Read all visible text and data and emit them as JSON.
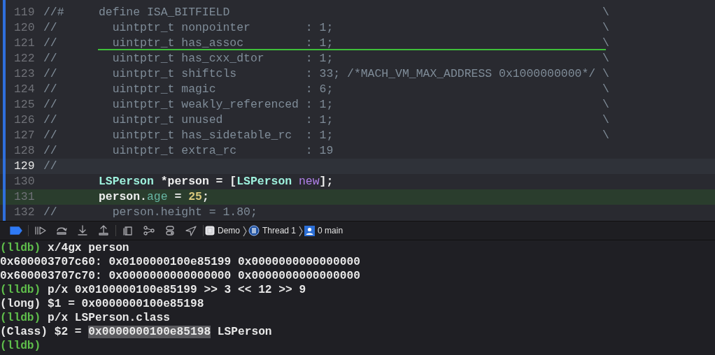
{
  "editor": {
    "lines": [
      {
        "number": "119",
        "cursor": false,
        "executing": false,
        "rule_below": false,
        "tokens": [
          {
            "text": "//#     define ISA_BITFIELD                                                      \\",
            "kind": "comment"
          }
        ]
      },
      {
        "number": "120",
        "cursor": false,
        "executing": false,
        "rule_below": false,
        "tokens": [
          {
            "text": "//        uintptr_t nonpointer        : 1;                                       \\",
            "kind": "comment"
          }
        ]
      },
      {
        "number": "121",
        "cursor": false,
        "executing": false,
        "rule_below": true,
        "tokens": [
          {
            "text": "//        uintptr_t has_assoc         : 1;                                       \\",
            "kind": "comment"
          }
        ]
      },
      {
        "number": "122",
        "cursor": false,
        "executing": false,
        "rule_below": false,
        "tokens": [
          {
            "text": "//        uintptr_t has_cxx_dtor      : 1;                                       \\",
            "kind": "comment"
          }
        ]
      },
      {
        "number": "123",
        "cursor": false,
        "executing": false,
        "rule_below": false,
        "tokens": [
          {
            "text": "//        uintptr_t shiftcls          : 33; /*MACH_VM_MAX_ADDRESS 0x1000000000*/ \\",
            "kind": "comment"
          }
        ]
      },
      {
        "number": "124",
        "cursor": false,
        "executing": false,
        "rule_below": false,
        "tokens": [
          {
            "text": "//        uintptr_t magic             : 6;                                       \\",
            "kind": "comment"
          }
        ]
      },
      {
        "number": "125",
        "cursor": false,
        "executing": false,
        "rule_below": false,
        "tokens": [
          {
            "text": "//        uintptr_t weakly_referenced : 1;                                       \\",
            "kind": "comment"
          }
        ]
      },
      {
        "number": "126",
        "cursor": false,
        "executing": false,
        "rule_below": false,
        "tokens": [
          {
            "text": "//        uintptr_t unused            : 1;                                       \\",
            "kind": "comment"
          }
        ]
      },
      {
        "number": "127",
        "cursor": false,
        "executing": false,
        "rule_below": false,
        "tokens": [
          {
            "text": "//        uintptr_t has_sidetable_rc  : 1;                                       \\",
            "kind": "comment"
          }
        ]
      },
      {
        "number": "128",
        "cursor": false,
        "executing": false,
        "rule_below": false,
        "tokens": [
          {
            "text": "//        uintptr_t extra_rc          : 19",
            "kind": "comment"
          }
        ]
      },
      {
        "number": "129",
        "cursor": true,
        "executing": false,
        "rule_below": false,
        "tokens": [
          {
            "text": "//",
            "kind": "comment"
          }
        ]
      },
      {
        "number": "130",
        "cursor": false,
        "executing": false,
        "rule_below": false,
        "tokens": [
          {
            "text": "        LSPerson",
            "kind": "class"
          },
          {
            "text": " *person = [",
            "kind": "plain"
          },
          {
            "text": "LSPerson",
            "kind": "class"
          },
          {
            "text": " new",
            "kind": "method"
          },
          {
            "text": "];",
            "kind": "plain"
          }
        ]
      },
      {
        "number": "131",
        "cursor": false,
        "executing": true,
        "rule_below": false,
        "tokens": [
          {
            "text": "        person.",
            "kind": "plain"
          },
          {
            "text": "age",
            "kind": "property"
          },
          {
            "text": " = ",
            "kind": "plain"
          },
          {
            "text": "25",
            "kind": "number"
          },
          {
            "text": ";",
            "kind": "plain"
          }
        ]
      },
      {
        "number": "132",
        "cursor": false,
        "executing": false,
        "rule_below": false,
        "tokens": [
          {
            "text": "//        person.height = 1.80;",
            "kind": "comment"
          }
        ]
      }
    ]
  },
  "debug_bar": {
    "breakpoints_active": true,
    "breadcrumbs": [
      {
        "label": "Demo",
        "kind": "app"
      },
      {
        "label": "Thread 1",
        "kind": "thread"
      },
      {
        "label": "0 main",
        "kind": "frame"
      }
    ]
  },
  "console": {
    "lines": [
      {
        "kind": "command",
        "prompt": "(lldb)",
        "text": "x/4gx person"
      },
      {
        "kind": "output",
        "parts": [
          {
            "text": "0x600003707c60: 0x0100000100e85199 0x0000000000000000",
            "selected": false
          }
        ]
      },
      {
        "kind": "output",
        "parts": [
          {
            "text": "0x600003707c70: 0x0000000000000000 0x0000000000000000",
            "selected": false
          }
        ]
      },
      {
        "kind": "command",
        "prompt": "(lldb)",
        "text": "p/x 0x0100000100e85199 >> 3 << 12 >> 9"
      },
      {
        "kind": "output",
        "parts": [
          {
            "text": "(long) $1 = 0x0000000100e85198",
            "selected": false
          }
        ]
      },
      {
        "kind": "command",
        "prompt": "(lldb)",
        "text": "p/x LSPerson.class"
      },
      {
        "kind": "output",
        "parts": [
          {
            "text": "(Class) $2 = ",
            "selected": false
          },
          {
            "text": "0x0000000100e85198",
            "selected": true
          },
          {
            "text": " LSPerson",
            "selected": false
          }
        ]
      },
      {
        "kind": "prompt",
        "prompt": "(lldb)"
      }
    ]
  }
}
